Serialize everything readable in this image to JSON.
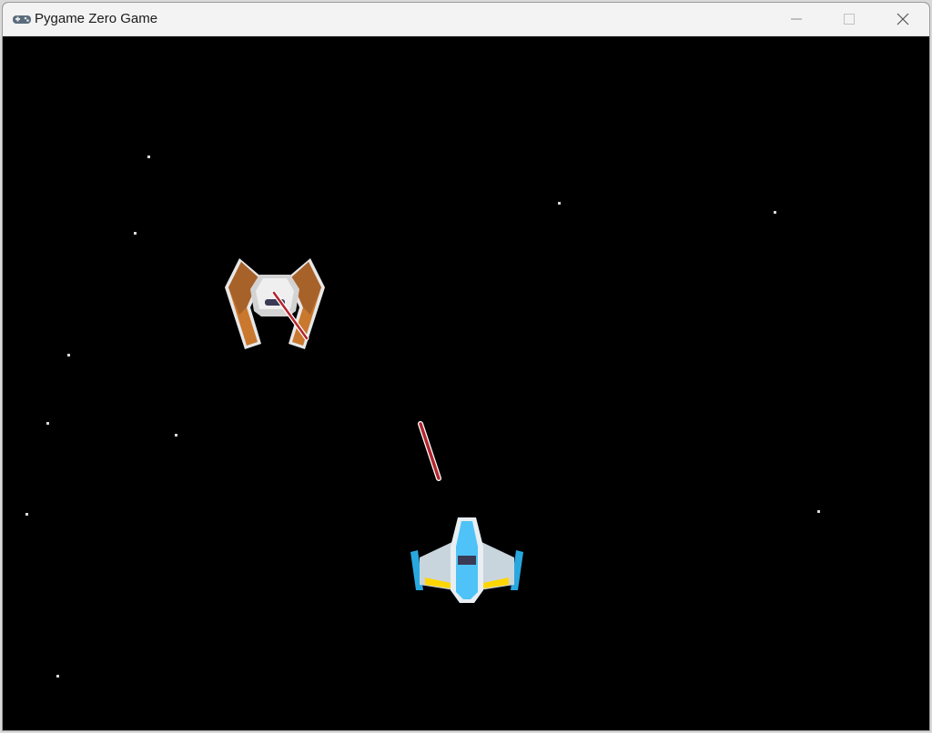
{
  "window": {
    "title": "Pygame Zero Game",
    "app_icon": "gamepad-icon",
    "controls": {
      "minimize_icon": "minimize-icon",
      "maximize_icon": "maximize-icon",
      "close_icon": "close-icon"
    }
  },
  "game": {
    "background_color": "#000000",
    "star_color": "#d8d8d8",
    "player_ship": {
      "icon": "player-spaceship-icon",
      "colors": {
        "hull": "#dfe8ee",
        "cockpit": "#4fc3f7",
        "trim": "#ffd600"
      }
    },
    "enemy_ship": {
      "icon": "enemy-spaceship-icon",
      "colors": {
        "wings": "#c9782e",
        "body": "#e7e7e7"
      }
    },
    "laser_color": "#b3262e"
  }
}
